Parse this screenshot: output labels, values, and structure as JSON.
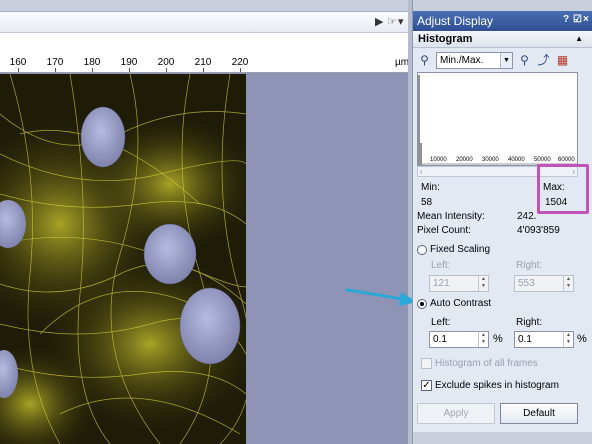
{
  "viewer": {
    "ruler_labels": [
      "160",
      "170",
      "180",
      "190",
      "200",
      "210",
      "220"
    ],
    "ruler_unit": "µm"
  },
  "panel": {
    "title": "Adjust Display",
    "title_controls": [
      "?",
      "☑",
      "×"
    ],
    "section_title": "Histogram",
    "mode_select": "Min./Max.",
    "histogram_axis_labels": [
      "10000",
      "20000",
      "30000",
      "40000",
      "50000",
      "60000"
    ],
    "stats": {
      "min_label": "Min:",
      "min_value": "58",
      "max_label": "Max:",
      "max_value": "1504",
      "mean_label": "Mean Intensity:",
      "mean_value": "242.",
      "pixel_label": "Pixel Count:",
      "pixel_value": "4'093'859"
    },
    "fixed_scaling": {
      "label": "Fixed Scaling",
      "selected": false,
      "left_label": "Left:",
      "left_value": "121",
      "right_label": "Right:",
      "right_value": "553"
    },
    "auto_contrast": {
      "label": "Auto Contrast",
      "selected": true,
      "left_label": "Left:",
      "left_value": "0.1",
      "right_label": "Right:",
      "right_value": "0.1",
      "unit": "%"
    },
    "histogram_all_frames": {
      "label": "Histogram of all frames",
      "checked": false
    },
    "exclude_spikes": {
      "label": "Exclude spikes in histogram",
      "checked": true
    },
    "buttons": {
      "apply": "Apply",
      "default": "Default"
    }
  },
  "colors": {
    "title_bar": "#3a5ba0",
    "highlight_box": "#c054b8",
    "callout_arrow": "#2aa8d8",
    "fluorescence": "#d8d23a",
    "nucleus": "#9ea3d0"
  }
}
